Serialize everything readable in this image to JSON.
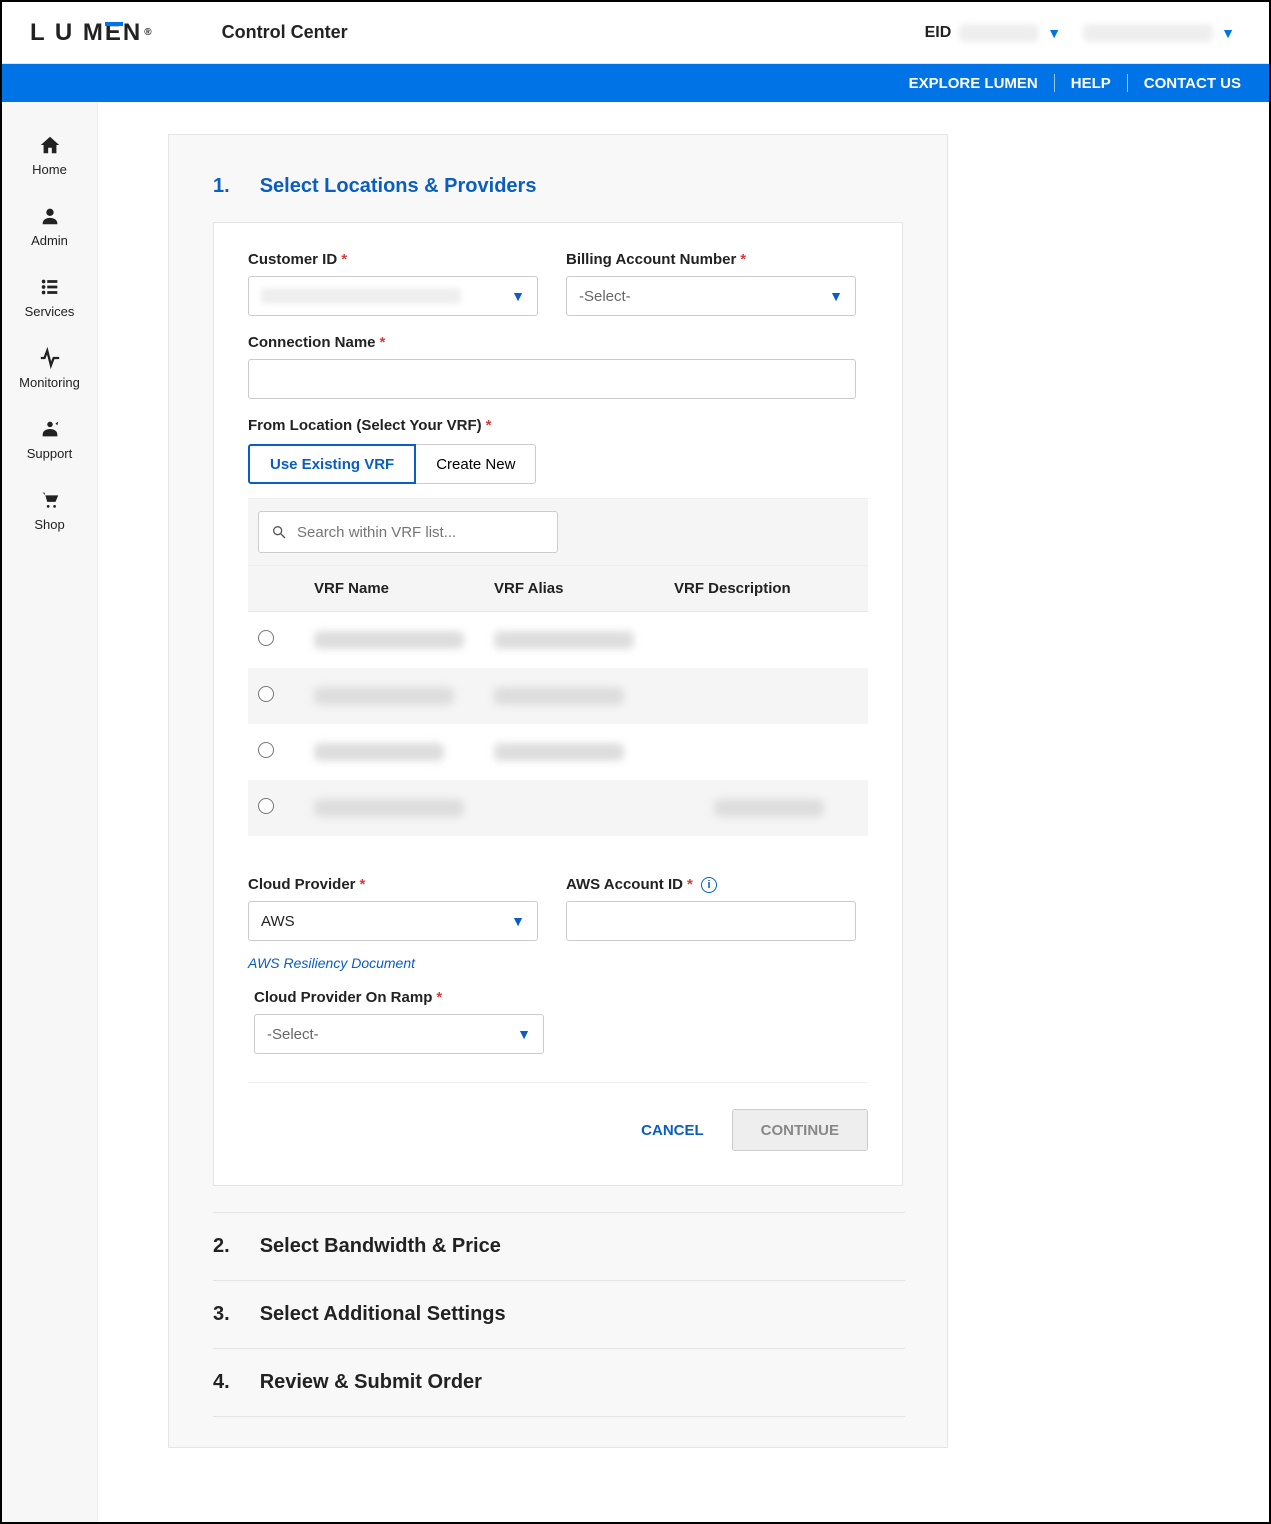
{
  "header": {
    "logo_text": "LUMEN",
    "app_name": "Control Center",
    "eid_label": "EID"
  },
  "bluebar": {
    "explore": "EXPLORE LUMEN",
    "help": "HELP",
    "contact": "CONTACT US"
  },
  "sidenav": [
    {
      "id": "home",
      "label": "Home"
    },
    {
      "id": "admin",
      "label": "Admin"
    },
    {
      "id": "services",
      "label": "Services"
    },
    {
      "id": "monitoring",
      "label": "Monitoring"
    },
    {
      "id": "support",
      "label": "Support"
    },
    {
      "id": "shop",
      "label": "Shop"
    }
  ],
  "steps": {
    "s1_num": "1.",
    "s1_title": "Select Locations & Providers",
    "s2_num": "2.",
    "s2_title": "Select Bandwidth & Price",
    "s3_num": "3.",
    "s3_title": "Select Additional Settings",
    "s4_num": "4.",
    "s4_title": "Review & Submit Order"
  },
  "form": {
    "customer_id_label": "Customer ID",
    "billing_label": "Billing Account Number",
    "billing_placeholder": "-Select-",
    "connection_name_label": "Connection Name",
    "from_location_label": "From Location (Select Your VRF)",
    "seg_existing": "Use Existing VRF",
    "seg_new": "Create New",
    "search_placeholder": "Search within VRF list...",
    "col_name": "VRF Name",
    "col_alias": "VRF Alias",
    "col_desc": "VRF Description",
    "cloud_provider_label": "Cloud Provider",
    "cloud_provider_value": "AWS",
    "aws_resiliency_link": "AWS Resiliency Document",
    "aws_account_label": "AWS Account ID",
    "on_ramp_label": "Cloud Provider On Ramp",
    "on_ramp_placeholder": "-Select-",
    "cancel": "CANCEL",
    "continue": "CONTINUE"
  },
  "vrf_rows": 4
}
